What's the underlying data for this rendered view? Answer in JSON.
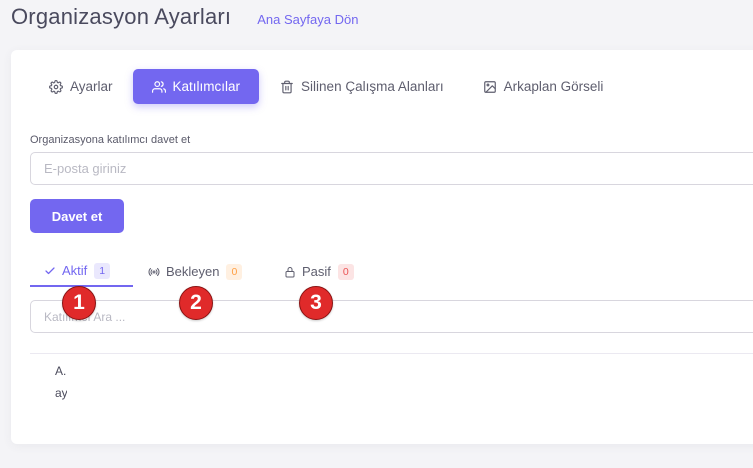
{
  "header": {
    "title": "Organizasyon Ayarları",
    "back_link": "Ana Sayfaya Dön"
  },
  "tabs": [
    {
      "label": "Ayarlar",
      "icon": "gear-icon",
      "active": false
    },
    {
      "label": "Katılımcılar",
      "icon": "users-icon",
      "active": true
    },
    {
      "label": "Silinen Çalışma Alanları",
      "icon": "trash-icon",
      "active": false
    },
    {
      "label": "Arkaplan Görseli",
      "icon": "image-icon",
      "active": false
    }
  ],
  "invite": {
    "label": "Organizasyona katılımcı davet et",
    "placeholder": "E-posta giriniz",
    "value": "",
    "button": "Davet et"
  },
  "subtabs": [
    {
      "label": "Aktif",
      "icon": "check-icon",
      "count": "1",
      "active": true
    },
    {
      "label": "Bekleyen",
      "icon": "broadcast-icon",
      "count": "0",
      "active": false
    },
    {
      "label": "Pasif",
      "icon": "lock-icon",
      "count": "0",
      "active": false
    }
  ],
  "search": {
    "placeholder": "Katılımcı Ara ..."
  },
  "participants": [
    {
      "name": "A.",
      "email": "ay"
    }
  ],
  "markers": [
    "1",
    "2",
    "3"
  ],
  "colors": {
    "accent": "#7367f0",
    "warning": "#ff9f43",
    "danger": "#ea5455",
    "marker": "#e02a2a"
  }
}
